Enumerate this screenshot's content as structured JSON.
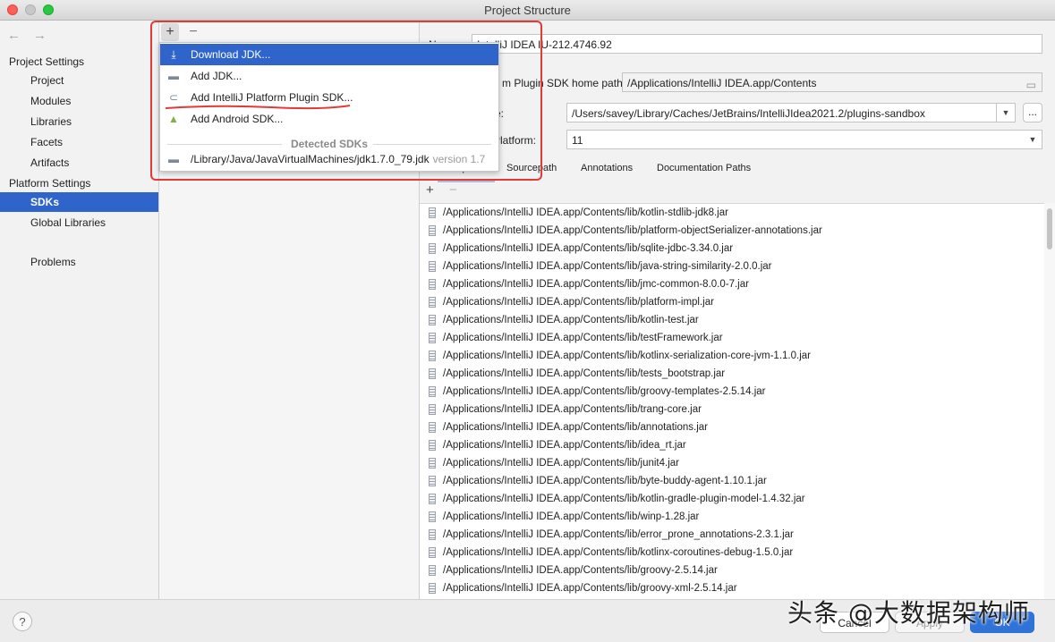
{
  "window": {
    "title": "Project Structure"
  },
  "sidebar": {
    "project_settings_label": "Project Settings",
    "project_items": [
      "Project",
      "Modules",
      "Libraries",
      "Facets",
      "Artifacts"
    ],
    "platform_settings_label": "Platform Settings",
    "platform_items": [
      "SDKs",
      "Global Libraries"
    ],
    "problems_label": "Problems"
  },
  "popup": {
    "items": [
      {
        "label": "Download JDK...",
        "icon": "download-icon"
      },
      {
        "label": "Add JDK...",
        "icon": "folder-icon"
      },
      {
        "label": "Add IntelliJ Platform Plugin SDK...",
        "icon": "plugin-icon"
      },
      {
        "label": "Add Android SDK...",
        "icon": "android-icon"
      }
    ],
    "detected_header": "Detected SDKs",
    "detected": {
      "path": "/Library/Java/JavaVirtualMachines/jdk1.7.0_79.jdk",
      "version": "version 1.7"
    }
  },
  "sdk": {
    "name_label": "Name:",
    "name_value": "IntelliJ IDEA IU-212.4746.92",
    "home_label": "m Plugin SDK home path:",
    "home_value": "/Applications/IntelliJ IDEA.app/Contents",
    "sandbox_label": "e:",
    "sandbox_value": "/Users/savey/Library/Caches/JetBrains/IntelliJIdea2021.2/plugins-sandbox",
    "dots_label": "...",
    "platform_label": "Platform:",
    "platform_value": "11"
  },
  "tabs": [
    "Classpath",
    "Sourcepath",
    "Annotations",
    "Documentation Paths"
  ],
  "classpath": [
    "/Applications/IntelliJ IDEA.app/Contents/lib/kotlin-stdlib-jdk8.jar",
    "/Applications/IntelliJ IDEA.app/Contents/lib/platform-objectSerializer-annotations.jar",
    "/Applications/IntelliJ IDEA.app/Contents/lib/sqlite-jdbc-3.34.0.jar",
    "/Applications/IntelliJ IDEA.app/Contents/lib/java-string-similarity-2.0.0.jar",
    "/Applications/IntelliJ IDEA.app/Contents/lib/jmc-common-8.0.0-7.jar",
    "/Applications/IntelliJ IDEA.app/Contents/lib/platform-impl.jar",
    "/Applications/IntelliJ IDEA.app/Contents/lib/kotlin-test.jar",
    "/Applications/IntelliJ IDEA.app/Contents/lib/testFramework.jar",
    "/Applications/IntelliJ IDEA.app/Contents/lib/kotlinx-serialization-core-jvm-1.1.0.jar",
    "/Applications/IntelliJ IDEA.app/Contents/lib/tests_bootstrap.jar",
    "/Applications/IntelliJ IDEA.app/Contents/lib/groovy-templates-2.5.14.jar",
    "/Applications/IntelliJ IDEA.app/Contents/lib/trang-core.jar",
    "/Applications/IntelliJ IDEA.app/Contents/lib/annotations.jar",
    "/Applications/IntelliJ IDEA.app/Contents/lib/idea_rt.jar",
    "/Applications/IntelliJ IDEA.app/Contents/lib/junit4.jar",
    "/Applications/IntelliJ IDEA.app/Contents/lib/byte-buddy-agent-1.10.1.jar",
    "/Applications/IntelliJ IDEA.app/Contents/lib/kotlin-gradle-plugin-model-1.4.32.jar",
    "/Applications/IntelliJ IDEA.app/Contents/lib/winp-1.28.jar",
    "/Applications/IntelliJ IDEA.app/Contents/lib/error_prone_annotations-2.3.1.jar",
    "/Applications/IntelliJ IDEA.app/Contents/lib/kotlinx-coroutines-debug-1.5.0.jar",
    "/Applications/IntelliJ IDEA.app/Contents/lib/groovy-2.5.14.jar",
    "/Applications/IntelliJ IDEA.app/Contents/lib/groovy-xml-2.5.14.jar"
  ],
  "buttons": {
    "help": "?",
    "cancel": "Cancel",
    "apply": "Apply",
    "ok": "OK"
  },
  "watermark": "头条 @大数据架构师",
  "colors": {
    "selection": "#2f65ca",
    "highlight_box": "#e53935",
    "ok_button": "#2f72d8"
  }
}
